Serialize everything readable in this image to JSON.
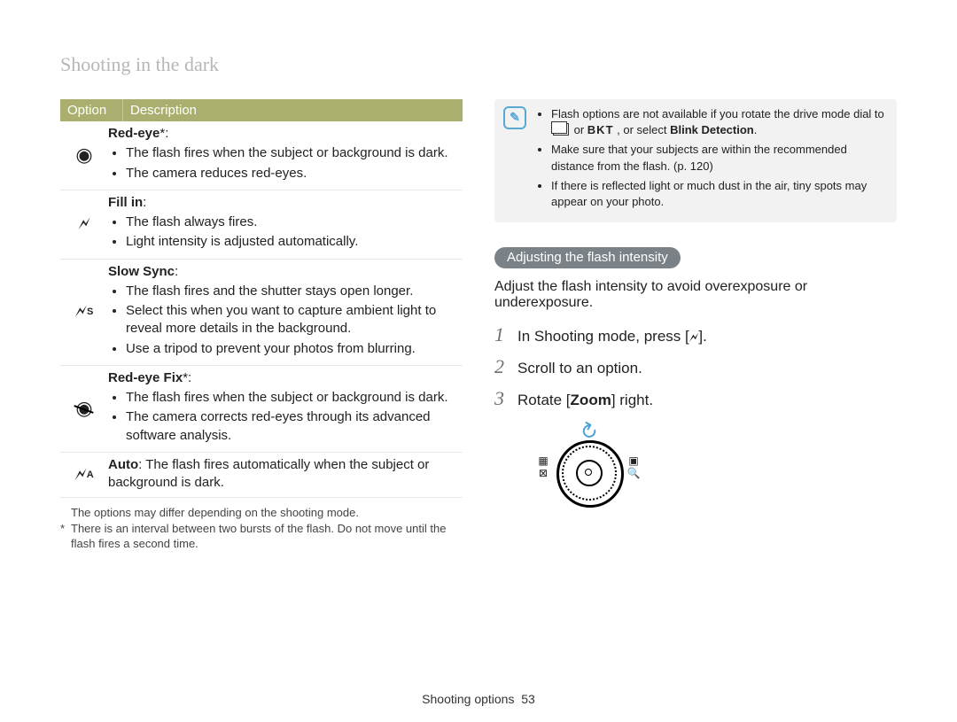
{
  "section_title": "Shooting in the dark",
  "table": {
    "header_option": "Option",
    "header_desc": "Description",
    "rows": [
      {
        "icon_name": "red-eye-icon",
        "name": "Red-eye",
        "asterisk": "*:",
        "bullets": [
          "The flash fires when the subject or background is dark.",
          "The camera reduces red-eyes."
        ]
      },
      {
        "icon_name": "fill-in-icon",
        "name": "Fill in",
        "asterisk": ":",
        "bullets": [
          "The flash always fires.",
          "Light intensity is adjusted automatically."
        ]
      },
      {
        "icon_name": "slow-sync-icon",
        "name": "Slow Sync",
        "asterisk": ":",
        "bullets": [
          "The flash fires and the shutter stays open longer.",
          "Select this when you want to capture ambient light to reveal more details in the background.",
          "Use a tripod to prevent your photos from blurring."
        ]
      },
      {
        "icon_name": "red-eye-fix-icon",
        "name": "Red-eye Fix",
        "asterisk": "*:",
        "bullets": [
          "The flash fires when the subject or background is dark.",
          "The camera corrects red-eyes through its advanced software analysis."
        ]
      },
      {
        "icon_name": "auto-flash-icon",
        "name": "Auto",
        "asterisk": ": ",
        "inline_text": "The flash fires automatically when the subject or background is dark."
      }
    ]
  },
  "footnotes": {
    "f1": "The options may differ depending on the shooting mode.",
    "f2": "There is an interval between two bursts of the flash. Do not move until the flash fires a second time."
  },
  "info": {
    "b1a": "Flash options are not available if you rotate the drive mode dial to ",
    "b1_or": " or ",
    "b1_bkt": "BKT",
    "b1b": ", or select ",
    "b1_bold": "Blink Detection",
    "b1c": ".",
    "b2": "Make sure that your subjects are within the recommended distance from the flash. (p. 120)",
    "b3": "If there is reflected light or much dust in the air, tiny spots may appear on your photo."
  },
  "adjust_heading": "Adjusting the flash intensity",
  "adjust_lead": "Adjust the flash intensity to avoid overexposure or underexposure.",
  "steps": {
    "s1a": "In Shooting mode, press [",
    "s1b": "].",
    "s2": "Scroll to an option.",
    "s3a": "Rotate [",
    "s3_zoom": "Zoom",
    "s3b": "] right."
  },
  "footer": {
    "label": "Shooting options",
    "page": "53"
  }
}
